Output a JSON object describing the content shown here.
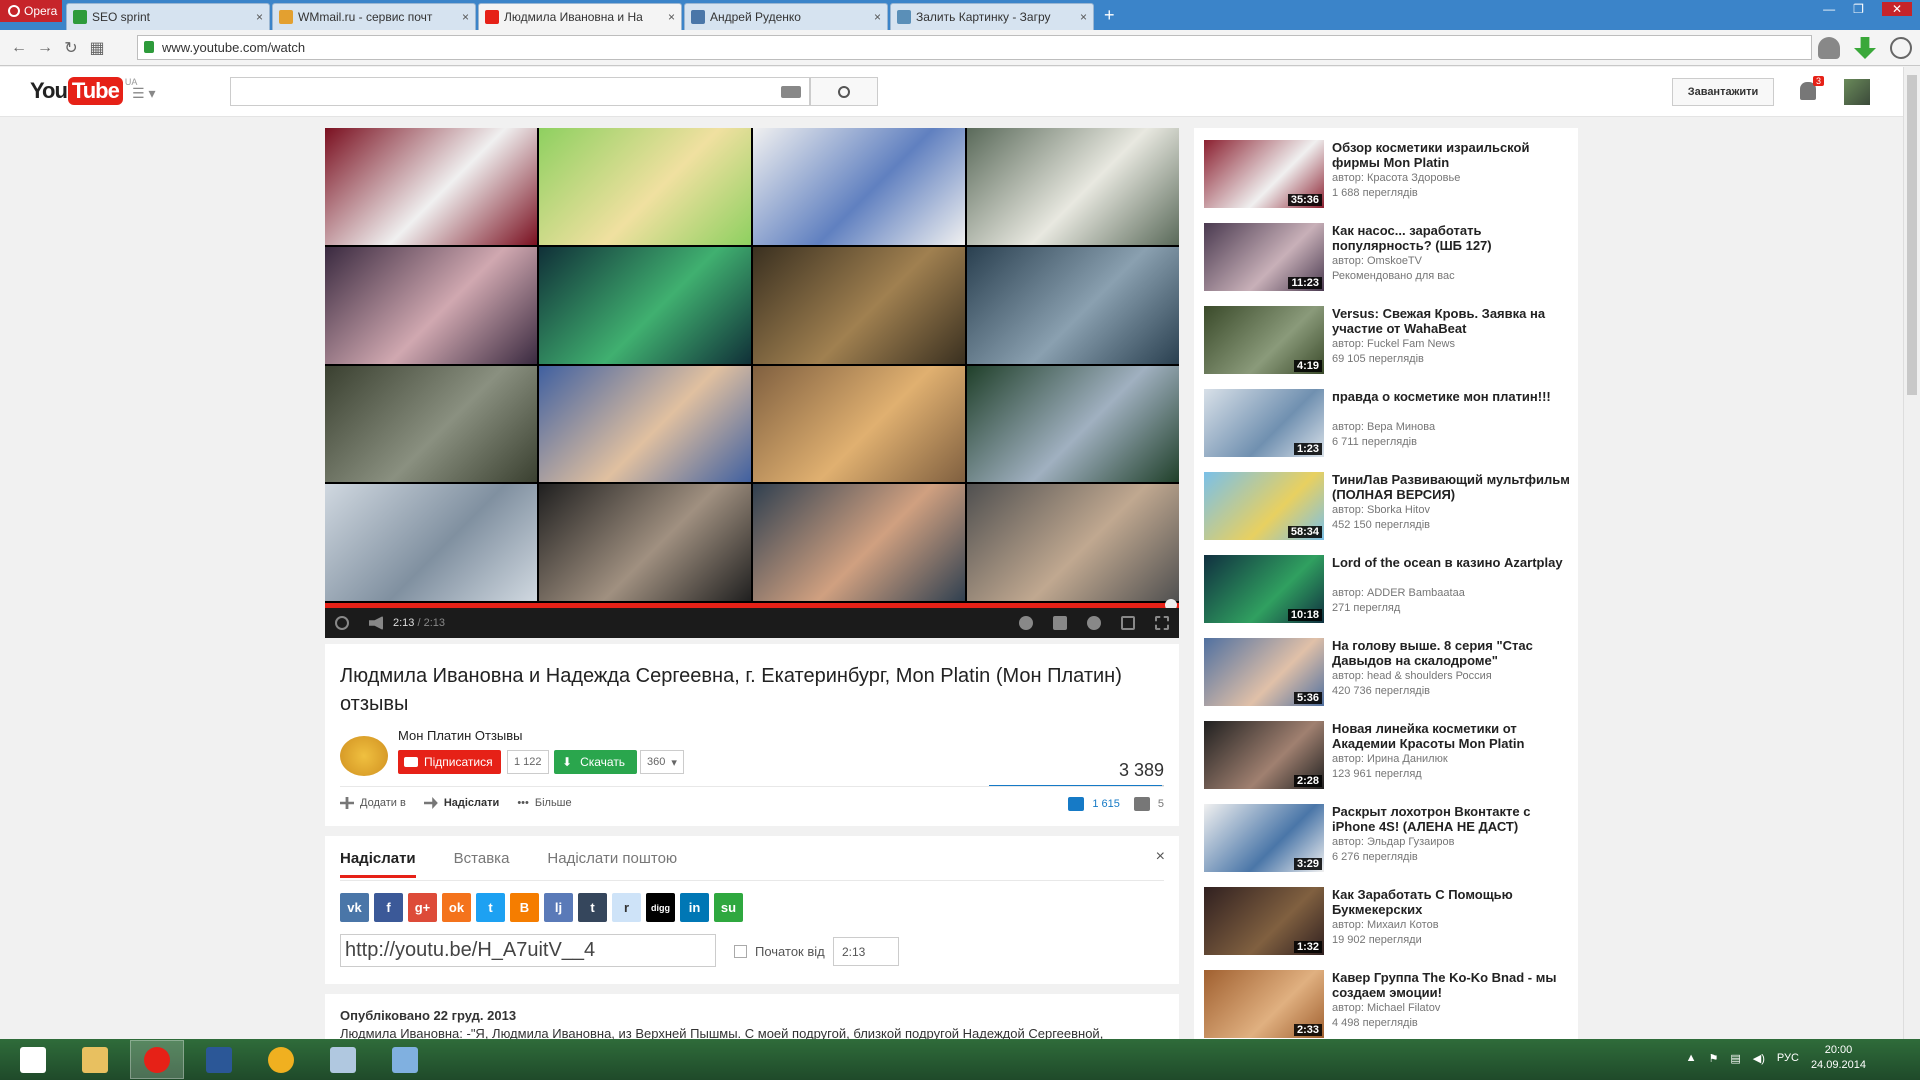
{
  "browser": {
    "menu_label": "Opera",
    "tabs": [
      {
        "title": "SEO sprint",
        "favicon_color": "#2e9b3b",
        "active": false
      },
      {
        "title": "WMmail.ru - сервис почт",
        "favicon_color": "#e3a030",
        "active": false
      },
      {
        "title": "Людмила Ивановна и На",
        "favicon_color": "#e62117",
        "active": true
      },
      {
        "title": "Андрей Руденко",
        "favicon_color": "#4a76a8",
        "active": false
      },
      {
        "title": "Залить Картинку - Загру",
        "favicon_color": "#5a8fb8",
        "active": false
      }
    ],
    "tab_close": "×",
    "new_tab": "+",
    "url": "www.youtube.com/watch"
  },
  "youtube": {
    "logo_you": "You",
    "logo_tube": "Tube",
    "logo_region": "UA",
    "upload_label": "Завантажити",
    "notifications_count": "3"
  },
  "player": {
    "current_time": "2:13",
    "duration": "/ 2:13",
    "progress": 1.0
  },
  "video": {
    "title": "Людмила Ивановна и Надежда Сергеевна, г. Екатеринбург, Mon Platin (Мон Платин) отзывы",
    "channel": "Мон Платин Отзывы",
    "subscribe_label": "Підписатися",
    "subscribers": "1 122",
    "download_label": "Скачать",
    "download_quality": "360",
    "views": "3 389",
    "add_to_label": "Додати в",
    "share_label": "Надіслати",
    "more_label": "Більше",
    "likes": "1 615",
    "dislikes": "5"
  },
  "share_panel": {
    "tabs": [
      "Надіслати",
      "Вставка",
      "Надіслати поштою"
    ],
    "close": "×",
    "url": "http://youtu.be/H_A7uitV__4",
    "start_label": "Початок від",
    "start_time": "2:13",
    "social": [
      {
        "name": "vk-icon",
        "glyph": "vk",
        "color": "#4a76a8"
      },
      {
        "name": "facebook-icon",
        "glyph": "f",
        "color": "#3b5998"
      },
      {
        "name": "google-plus-icon",
        "glyph": "g+",
        "color": "#dd4b39"
      },
      {
        "name": "odnoklassniki-icon",
        "glyph": "ok",
        "color": "#f4731c"
      },
      {
        "name": "twitter-icon",
        "glyph": "t",
        "color": "#1da1f2"
      },
      {
        "name": "blogger-icon",
        "glyph": "B",
        "color": "#f57d00"
      },
      {
        "name": "livejournal-icon",
        "glyph": "lj",
        "color": "#5a7ab8"
      },
      {
        "name": "tumblr-icon",
        "glyph": "t",
        "color": "#35465c"
      },
      {
        "name": "reddit-icon",
        "glyph": "r",
        "color": "#cee3f8"
      },
      {
        "name": "digg-icon",
        "glyph": "digg",
        "color": "#000000"
      },
      {
        "name": "linkedin-icon",
        "glyph": "in",
        "color": "#0077b5"
      },
      {
        "name": "stumbleupon-icon",
        "glyph": "su",
        "color": "#2fa83f"
      }
    ]
  },
  "description": {
    "published": "Опубліковано 22 груд. 2013",
    "text": "Людмила Ивановна: -\"Я, Людмила Ивановна, из Верхней Пышмы. С моей подругой, близкой подругой Надеждой Сергеевной,"
  },
  "related": [
    {
      "title": "Обзор косметики израильской фирмы Mon Platin",
      "author": "автор: Красота Здоровье",
      "views": "1 688 переглядів",
      "duration": "35:36",
      "c1": "#8b2030",
      "c2": "#f0f0f0"
    },
    {
      "title": "Как насос... заработать популярность? (ШБ 127)",
      "author": "автор: OmskoeTV",
      "views": "Рекомендовано для вас",
      "duration": "11:23",
      "c1": "#4a3a50",
      "c2": "#c8b0b8"
    },
    {
      "title": "Versus: Свежая Кровь. Заявка на участие от WahaBeat",
      "author": "автор: Fuckel Fam News",
      "views": "69 105 переглядів",
      "duration": "4:19",
      "c1": "#3a4a2a",
      "c2": "#8a9a7a"
    },
    {
      "title": "правда о косметике мон платин!!!",
      "author": "автор: Вера Минова",
      "views": "6 711 переглядів",
      "duration": "1:23",
      "c1": "#d8e0e8",
      "c2": "#7090b0"
    },
    {
      "title": "ТиниЛав Развивающий мультфильм (ПОЛНАЯ ВЕРСИЯ)",
      "author": "автор: Sborka Hitov",
      "views": "452 150 переглядів",
      "duration": "58:34",
      "c1": "#7ac0e8",
      "c2": "#e8d060"
    },
    {
      "title": "Lord of the ocean в казино Azartplay",
      "author": "автор: ADDER Bambaataa",
      "views": "271 перегляд",
      "duration": "10:18",
      "c1": "#103040",
      "c2": "#30a060"
    },
    {
      "title": "На голову выше. 8 серия \"Стас Давыдов на скалодроме\"",
      "author": "автор: head & shoulders Россия",
      "views": "420 736 переглядів",
      "duration": "5:36",
      "c1": "#5070a0",
      "c2": "#e0c0a8"
    },
    {
      "title": "Новая линейка косметики от Академии Красоты Mon Platin",
      "author": "автор: Ирина Данилюк",
      "views": "123 961 перегляд",
      "duration": "2:28",
      "c1": "#202020",
      "c2": "#a08070"
    },
    {
      "title": "Раскрыт лохотрон Вконтакте с iPhone 4S! (АЛЕНА НЕ ДАСТ)",
      "author": "автор: Эльдар Гузаиров",
      "views": "6 276 переглядів",
      "duration": "3:29",
      "c1": "#f0f0f0",
      "c2": "#4a76a8"
    },
    {
      "title": "Как Заработать С Помощью Букмекерских",
      "author": "автор: Михаил Котов",
      "views": "19 902 перегляди",
      "duration": "1:32",
      "c1": "#302020",
      "c2": "#806040"
    },
    {
      "title": "Кавер Группа The Ko-Ko Bnad - мы создаем эмоции!",
      "author": "автор: Michael Filatov",
      "views": "4 498 переглядів",
      "duration": "2:33",
      "c1": "#a06030",
      "c2": "#e0b080"
    }
  ],
  "player_grid_colors": [
    [
      "#7a1020",
      "#f0f0f0"
    ],
    [
      "#8ed060",
      "#f0e0a0"
    ],
    [
      "#f0f0f0",
      "#6080c0"
    ],
    [
      "#5a6a5a",
      "#e8e8e0"
    ],
    [
      "#3a2a40",
      "#d0a8b0"
    ],
    [
      "#103038",
      "#40b070"
    ],
    [
      "#3a3020",
      "#a08050"
    ],
    [
      "#2a4050",
      "#8aa0b0"
    ],
    [
      "#3a4030",
      "#8a9080"
    ],
    [
      "#4060a0",
      "#e0c0a0"
    ],
    [
      "#806040",
      "#e0b070"
    ],
    [
      "#20402a",
      "#a0b0c0"
    ],
    [
      "#d0d8e0",
      "#8090a0"
    ],
    [
      "#202020",
      "#a09080"
    ],
    [
      "#304050",
      "#d0a080"
    ],
    [
      "#505050",
      "#c0a890"
    ]
  ],
  "taskbar": {
    "apps": [
      "windows-start-icon",
      "explorer-icon",
      "opera-icon",
      "word-icon",
      "aimp-icon",
      "paint-icon",
      "audio-icon"
    ],
    "language": "РУС",
    "time": "20:00",
    "date": "24.09.2014"
  }
}
